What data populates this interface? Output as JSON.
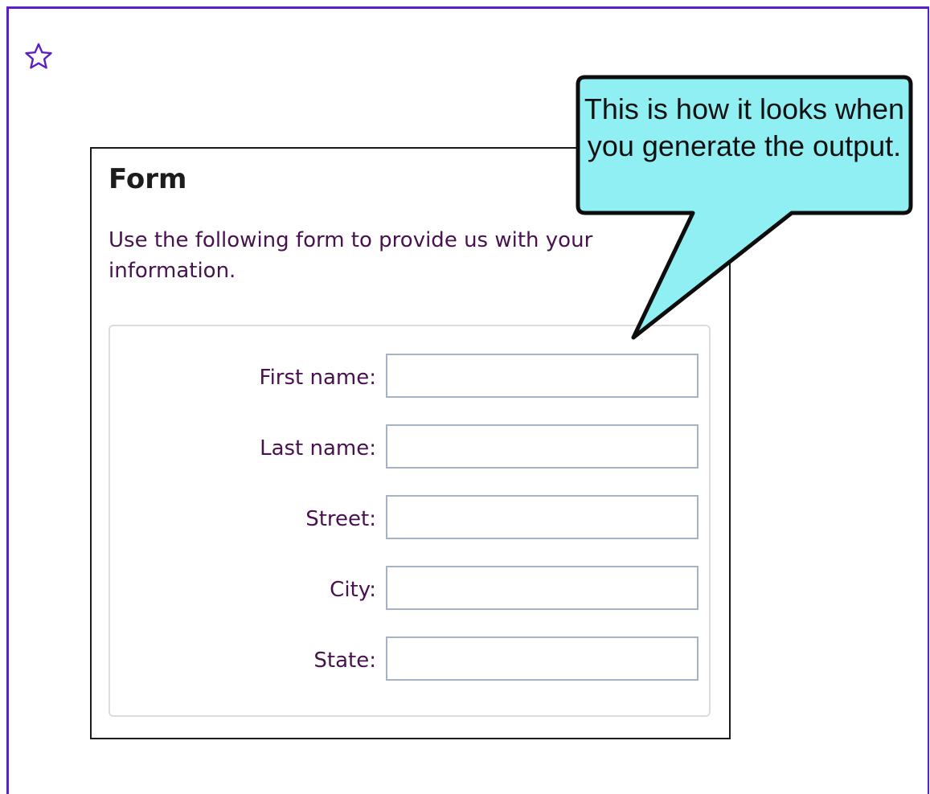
{
  "icons": {
    "bookmark_star": "star-outline-icon"
  },
  "colors": {
    "frame_border": "#5b1ec7",
    "callout_fill": "#8feff2",
    "label_text": "#4a1150",
    "input_border": "#a7b3c4"
  },
  "form": {
    "title": "Form",
    "description": "Use the following form to provide us with your information.",
    "fields": [
      {
        "label": "First name:",
        "value": ""
      },
      {
        "label": "Last name:",
        "value": ""
      },
      {
        "label": "Street:",
        "value": ""
      },
      {
        "label": "City:",
        "value": ""
      },
      {
        "label": "State:",
        "value": ""
      }
    ]
  },
  "callout": {
    "text": "This is how it looks when you generate the output."
  }
}
